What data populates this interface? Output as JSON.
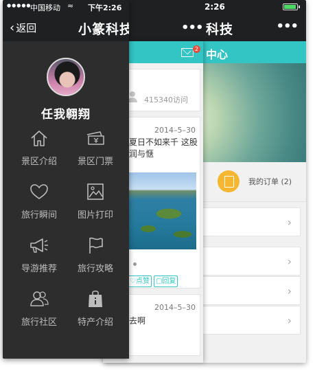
{
  "back_phone": {
    "status": {
      "time": "2:26"
    },
    "nav": {
      "title": "科技",
      "more_label": "•••"
    },
    "bar": {
      "title": "中心"
    },
    "order": {
      "label": "我的订单 (2)"
    },
    "list_rows": 5
  },
  "middle_panel": {
    "mail_badge": "2",
    "visits": "415340访问",
    "posts": [
      {
        "date": "2014–5–30",
        "text": "了夏日不如来千  这股温润与惬",
        "actions": {
          "like": "♡点赞",
          "reply": "▢回复"
        }
      },
      {
        "date": "2014–5–30",
        "text": "想去啊"
      }
    ]
  },
  "drawer": {
    "status": {
      "signal": "●●●●●",
      "carrier": "中国移动",
      "wifi": "≈",
      "time": "下午2:26"
    },
    "nav": {
      "back_label": "返回",
      "title": "小篆科技",
      "more_label": "•••"
    },
    "username": "任我翱翔",
    "menu": [
      {
        "label": "景区介绍",
        "icon": "home-icon"
      },
      {
        "label": "景区门票",
        "icon": "ticket-icon"
      },
      {
        "label": "旅行瞬间",
        "icon": "heart-icon"
      },
      {
        "label": "图片打印",
        "icon": "image-icon"
      },
      {
        "label": "导游推荐",
        "icon": "megaphone-icon"
      },
      {
        "label": "旅行攻略",
        "icon": "flag-icon"
      },
      {
        "label": "旅行社区",
        "icon": "users-icon"
      },
      {
        "label": "特产介绍",
        "icon": "gift-bag-icon"
      }
    ]
  },
  "colors": {
    "accent": "#33c4c4",
    "drawer_bg": "#2d2d2d",
    "nav_bg": "#1e2021",
    "order_icon": "#f5b731",
    "badge": "#e74c3c"
  }
}
